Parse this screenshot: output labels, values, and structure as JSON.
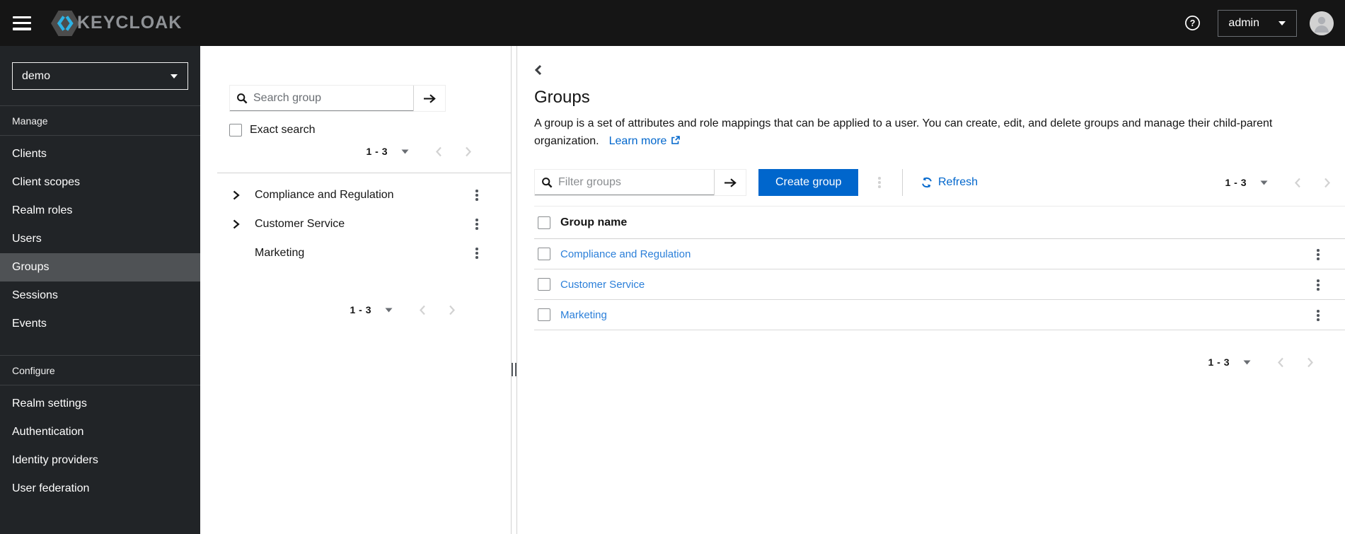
{
  "topbar": {
    "brand": "KEYCLOAK",
    "user_menu": {
      "label": "admin"
    }
  },
  "sidebar": {
    "realm_selector": {
      "value": "demo"
    },
    "sections": [
      {
        "label": "Manage",
        "items": [
          {
            "label": "Clients"
          },
          {
            "label": "Client scopes"
          },
          {
            "label": "Realm roles"
          },
          {
            "label": "Users"
          },
          {
            "label": "Groups",
            "selected": true
          },
          {
            "label": "Sessions"
          },
          {
            "label": "Events"
          }
        ]
      },
      {
        "label": "Configure",
        "items": [
          {
            "label": "Realm settings"
          },
          {
            "label": "Authentication"
          },
          {
            "label": "Identity providers"
          },
          {
            "label": "User federation"
          }
        ]
      }
    ]
  },
  "tree_panel": {
    "search_placeholder": "Search group",
    "exact_search_label": "Exact search",
    "pagination_top": {
      "range": "1 - 3"
    },
    "items": [
      {
        "name": "Compliance and Regulation",
        "expandable": true
      },
      {
        "name": "Customer Service",
        "expandable": true
      },
      {
        "name": "Marketing",
        "expandable": false
      }
    ],
    "pagination_bottom": {
      "range": "1 - 3"
    }
  },
  "main": {
    "title": "Groups",
    "description": "A group is a set of attributes and role mappings that can be applied to a user. You can create, edit, and delete groups and manage their child-parent organization.",
    "learn_more_label": "Learn more",
    "toolbar": {
      "filter_placeholder": "Filter groups",
      "create_button_label": "Create group",
      "refresh_label": "Refresh",
      "pagination": {
        "range": "1 - 3"
      }
    },
    "table": {
      "column_header": "Group name",
      "rows": [
        {
          "name": "Compliance and Regulation"
        },
        {
          "name": "Customer Service"
        },
        {
          "name": "Marketing"
        }
      ]
    },
    "pagination_bottom": {
      "range": "1 - 3"
    }
  },
  "colors": {
    "topbar_bg": "#151515",
    "sidebar_bg": "#212427",
    "nav_selected_bg": "#4f5255",
    "primary": "#0066cc",
    "link": "#0066cc",
    "table_link": "#2b7fd9",
    "disabled": "#d2d2d2",
    "logo_cyan": "#2db3e6"
  }
}
